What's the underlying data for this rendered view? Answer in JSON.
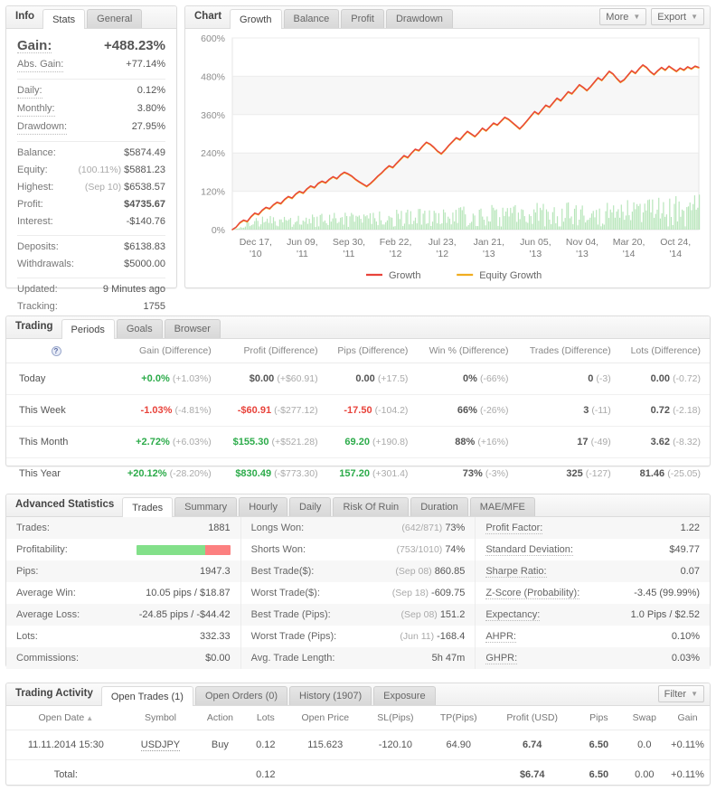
{
  "info": {
    "title": "Info",
    "tabs": [
      {
        "label": "Stats",
        "active": true
      },
      {
        "label": "General",
        "active": false
      }
    ],
    "gain_label": "Gain:",
    "gain_value": "+488.23%",
    "rows_block1": [
      {
        "label": "Abs. Gain:",
        "value": "+77.14%",
        "color": "green",
        "dotted": true
      }
    ],
    "rows_block2": [
      {
        "label": "Daily:",
        "value": "0.12%",
        "dotted": true
      },
      {
        "label": "Monthly:",
        "value": "3.80%",
        "dotted": true
      },
      {
        "label": "Drawdown:",
        "value": "27.95%",
        "dotted": true
      }
    ],
    "rows_block3": [
      {
        "label": "Balance:",
        "value": "$5874.49"
      },
      {
        "label": "Equity:",
        "value": "$5881.23",
        "pre": "(100.11%)"
      },
      {
        "label": "Highest:",
        "value": "$6538.57",
        "pre": "(Sep 10)"
      },
      {
        "label": "Profit:",
        "value": "$4735.67",
        "color": "green"
      },
      {
        "label": "Interest:",
        "value": "-$140.76"
      }
    ],
    "rows_block4": [
      {
        "label": "Deposits:",
        "value": "$6138.83"
      },
      {
        "label": "Withdrawals:",
        "value": "$5000.00"
      }
    ],
    "rows_block5": [
      {
        "label": "Updated:",
        "value": "9 Minutes ago"
      },
      {
        "label": "Tracking:",
        "value": "1755"
      }
    ]
  },
  "chart": {
    "title": "Chart",
    "tabs": [
      {
        "label": "Growth",
        "active": true
      },
      {
        "label": "Balance",
        "active": false
      },
      {
        "label": "Profit",
        "active": false
      },
      {
        "label": "Drawdown",
        "active": false
      }
    ],
    "more_label": "More",
    "export_label": "Export"
  },
  "chart_data": {
    "type": "line",
    "title": "Growth",
    "xlabel": "",
    "ylabel": "",
    "ylim": [
      0,
      600
    ],
    "yticks": [
      "0%",
      "120%",
      "240%",
      "360%",
      "480%",
      "600%"
    ],
    "ytick_values": [
      0,
      120,
      240,
      360,
      480,
      600
    ],
    "grid": true,
    "legend_position": "bottom",
    "legend": [
      {
        "name": "Growth",
        "color": "#e8433b"
      },
      {
        "name": "Equity Growth",
        "color": "#f0ad20"
      }
    ],
    "xticks": [
      "Dec 17, '10",
      "Jun 09, '11",
      "Sep 30, '11",
      "Feb 22, '12",
      "Jul 23, '12",
      "Jan 21, '13",
      "Jun 05, '13",
      "Nov 04, '13",
      "Mar 20, '14",
      "Oct 24, '14"
    ],
    "series": [
      {
        "name": "Growth",
        "color": "#e8433b",
        "values": [
          0,
          8,
          22,
          30,
          26,
          41,
          52,
          48,
          61,
          70,
          66,
          78,
          86,
          82,
          95,
          104,
          99,
          112,
          120,
          115,
          128,
          137,
          132,
          145,
          152,
          147,
          158,
          166,
          160,
          172,
          180,
          175,
          168,
          158,
          150,
          143,
          136,
          145,
          156,
          168,
          178,
          190,
          200,
          195,
          208,
          220,
          232,
          226,
          240,
          252,
          248,
          262,
          274,
          268,
          258,
          246,
          238,
          250,
          264,
          276,
          288,
          282,
          296,
          308,
          300,
          292,
          304,
          318,
          310,
          322,
          334,
          328,
          340,
          352,
          346,
          336,
          326,
          316,
          328,
          342,
          356,
          370,
          362,
          376,
          390,
          384,
          398,
          412,
          404,
          418,
          432,
          426,
          440,
          454,
          446,
          436,
          448,
          462,
          476,
          468,
          482,
          496,
          488,
          474,
          462,
          470,
          484,
          498,
          490,
          504,
          516,
          508,
          495,
          486,
          498,
          508,
          500,
          512,
          504,
          496,
          506,
          500,
          510,
          504,
          512,
          508
        ]
      },
      {
        "name": "Equity Growth",
        "color": "#f0ad20",
        "values": [
          0,
          7,
          20,
          28,
          24,
          39,
          50,
          46,
          59,
          68,
          64,
          76,
          84,
          80,
          93,
          102,
          97,
          110,
          118,
          113,
          126,
          135,
          130,
          143,
          150,
          145,
          156,
          164,
          158,
          170,
          178,
          173,
          166,
          156,
          148,
          141,
          134,
          143,
          154,
          166,
          176,
          188,
          198,
          193,
          206,
          218,
          230,
          224,
          238,
          250,
          246,
          260,
          272,
          266,
          256,
          244,
          236,
          248,
          262,
          274,
          286,
          280,
          294,
          306,
          298,
          290,
          302,
          316,
          308,
          320,
          332,
          326,
          338,
          350,
          344,
          334,
          324,
          314,
          326,
          340,
          354,
          368,
          360,
          374,
          388,
          382,
          396,
          410,
          402,
          416,
          430,
          424,
          438,
          452,
          444,
          434,
          446,
          460,
          474,
          466,
          480,
          494,
          486,
          472,
          460,
          468,
          482,
          496,
          488,
          502,
          514,
          506,
          493,
          484,
          496,
          506,
          498,
          510,
          502,
          494,
          504,
          498,
          508,
          502,
          510,
          506
        ]
      }
    ],
    "volume": {
      "name": "Volume",
      "color": "#b8e6bb",
      "note": "light green vertical bars along baseline"
    }
  },
  "trading": {
    "title": "Trading",
    "tabs": [
      {
        "label": "Periods",
        "active": true
      },
      {
        "label": "Goals",
        "active": false
      },
      {
        "label": "Browser",
        "active": false
      }
    ],
    "headers": [
      "",
      "Gain (Difference)",
      "Profit (Difference)",
      "Pips (Difference)",
      "Win % (Difference)",
      "Trades (Difference)",
      "Lots (Difference)"
    ],
    "rows": [
      {
        "period": "Today",
        "cells": [
          {
            "main": "+0.0%",
            "diff": "(+1.03%)",
            "color": "green"
          },
          {
            "main": "$0.00",
            "diff": "(+$60.91)",
            "color": "dark"
          },
          {
            "main": "0.00",
            "diff": "(+17.5)",
            "color": "dark"
          },
          {
            "main": "0%",
            "diff": "(-66%)",
            "color": "dark"
          },
          {
            "main": "0",
            "diff": "(-3)",
            "color": "dark"
          },
          {
            "main": "0.00",
            "diff": "(-0.72)",
            "color": "dark"
          }
        ]
      },
      {
        "period": "This Week",
        "cells": [
          {
            "main": "-1.03%",
            "diff": "(-4.81%)",
            "color": "red"
          },
          {
            "main": "-$60.91",
            "diff": "(-$277.12)",
            "color": "red"
          },
          {
            "main": "-17.50",
            "diff": "(-104.2)",
            "color": "red"
          },
          {
            "main": "66%",
            "diff": "(-26%)",
            "color": "dark"
          },
          {
            "main": "3",
            "diff": "(-11)",
            "color": "dark"
          },
          {
            "main": "0.72",
            "diff": "(-2.18)",
            "color": "dark"
          }
        ]
      },
      {
        "period": "This Month",
        "cells": [
          {
            "main": "+2.72%",
            "diff": "(+6.03%)",
            "color": "green"
          },
          {
            "main": "$155.30",
            "diff": "(+$521.28)",
            "color": "green"
          },
          {
            "main": "69.20",
            "diff": "(+190.8)",
            "color": "green"
          },
          {
            "main": "88%",
            "diff": "(+16%)",
            "color": "dark"
          },
          {
            "main": "17",
            "diff": "(-49)",
            "color": "dark"
          },
          {
            "main": "3.62",
            "diff": "(-8.32)",
            "color": "dark"
          }
        ]
      },
      {
        "period": "This Year",
        "cells": [
          {
            "main": "+20.12%",
            "diff": "(-28.20%)",
            "color": "green"
          },
          {
            "main": "$830.49",
            "diff": "(-$773.30)",
            "color": "green"
          },
          {
            "main": "157.20",
            "diff": "(+301.4)",
            "color": "green"
          },
          {
            "main": "73%",
            "diff": "(-3%)",
            "color": "dark"
          },
          {
            "main": "325",
            "diff": "(-127)",
            "color": "dark"
          },
          {
            "main": "81.46",
            "diff": "(-25.05)",
            "color": "dark"
          }
        ]
      }
    ]
  },
  "advanced": {
    "title": "Advanced Statistics",
    "tabs": [
      {
        "label": "Trades",
        "active": true
      },
      {
        "label": "Summary",
        "active": false
      },
      {
        "label": "Hourly",
        "active": false
      },
      {
        "label": "Daily",
        "active": false
      },
      {
        "label": "Risk Of Ruin",
        "active": false
      },
      {
        "label": "Duration",
        "active": false
      },
      {
        "label": "MAE/MFE",
        "active": false
      }
    ],
    "col1": [
      {
        "label": "Trades:",
        "value": "1881"
      },
      {
        "label": "Profitability:",
        "value": "",
        "bar": {
          "green": 73,
          "red": 27
        }
      },
      {
        "label": "Pips:",
        "value": "1947.3"
      },
      {
        "label": "Average Win:",
        "value": "10.05 pips / $18.87"
      },
      {
        "label": "Average Loss:",
        "value": "-24.85 pips / -$44.42"
      },
      {
        "label": "Lots:",
        "value": "332.33"
      },
      {
        "label": "Commissions:",
        "value": "$0.00"
      }
    ],
    "col2": [
      {
        "label": "Longs Won:",
        "pre": "(642/871)",
        "value": "73%"
      },
      {
        "label": "Shorts Won:",
        "pre": "(753/1010)",
        "value": "74%"
      },
      {
        "label": "Best Trade($):",
        "pre": "(Sep 08)",
        "value": "860.85"
      },
      {
        "label": "Worst Trade($):",
        "pre": "(Sep 18)",
        "value": "-609.75"
      },
      {
        "label": "Best Trade (Pips):",
        "pre": "(Sep 08)",
        "value": "151.2"
      },
      {
        "label": "Worst Trade (Pips):",
        "pre": "(Jun 11)",
        "value": "-168.4"
      },
      {
        "label": "Avg. Trade Length:",
        "pre": "",
        "value": "5h 47m"
      }
    ],
    "col3": [
      {
        "label": "Profit Factor:",
        "value": "1.22",
        "dotted": true
      },
      {
        "label": "Standard Deviation:",
        "value": "$49.77",
        "dotted": true
      },
      {
        "label": "Sharpe Ratio:",
        "value": "0.07",
        "dotted": true
      },
      {
        "label": "Z-Score (Probability):",
        "value": "-3.45 (99.99%)",
        "dotted": true
      },
      {
        "label": "Expectancy:",
        "value": "1.0 Pips / $2.52",
        "dotted": true
      },
      {
        "label": "AHPR:",
        "value": "0.10%",
        "dotted": true
      },
      {
        "label": "GHPR:",
        "value": "0.03%",
        "dotted": true
      }
    ]
  },
  "activity": {
    "title": "Trading Activity",
    "tabs": [
      {
        "label": "Open Trades (1)",
        "active": true
      },
      {
        "label": "Open Orders (0)",
        "active": false
      },
      {
        "label": "History (1907)",
        "active": false
      },
      {
        "label": "Exposure",
        "active": false
      }
    ],
    "filter_label": "Filter",
    "headers": [
      "Open Date",
      "Symbol",
      "Action",
      "Lots",
      "Open Price",
      "SL(Pips)",
      "TP(Pips)",
      "Profit (USD)",
      "Pips",
      "Swap",
      "Gain"
    ],
    "rows": [
      {
        "open_date": "11.11.2014 15:30",
        "symbol": "USDJPY",
        "action": "Buy",
        "lots": "0.12",
        "open_price": "115.623",
        "sl": "-120.10",
        "tp": "64.90",
        "profit": "6.74",
        "pips": "6.50",
        "swap": "0.0",
        "gain": "+0.11%"
      }
    ],
    "total": {
      "label": "Total:",
      "lots": "0.12",
      "profit": "$6.74",
      "pips": "6.50",
      "swap": "0.00",
      "gain": "+0.11%"
    }
  },
  "colors": {
    "green": "#2cab4a",
    "red": "#e8433b",
    "growth_line": "#e8433b",
    "equity_line": "#f0ad20",
    "volume_bar": "#b8e6bb",
    "panel_border": "#dcdcdc"
  }
}
